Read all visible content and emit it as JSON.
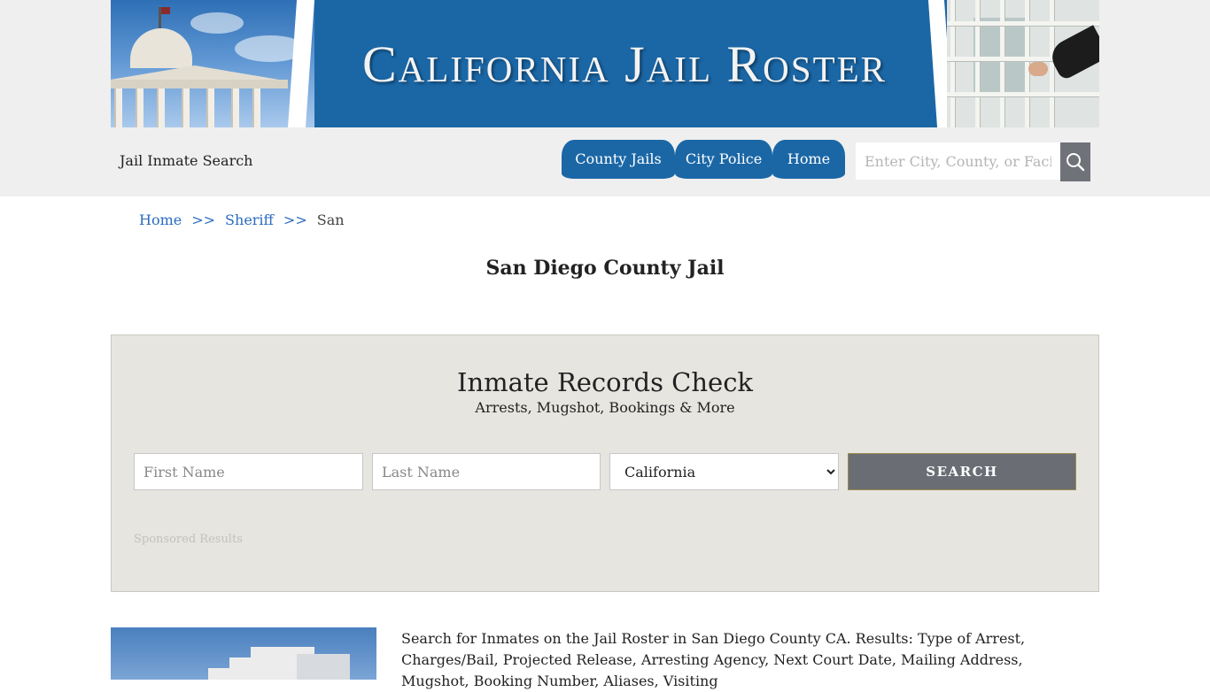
{
  "banner": {
    "title": "California Jail Roster"
  },
  "header": {
    "site_name": "Jail Inmate Search",
    "nav": [
      {
        "label": "County Jails"
      },
      {
        "label": "City Police"
      },
      {
        "label": "Home"
      }
    ],
    "search_placeholder": "Enter City, County, or Facility"
  },
  "breadcrumb": {
    "items": [
      "Home",
      "Sheriff"
    ],
    "separator": ">>",
    "current": "San"
  },
  "page": {
    "title": "San Diego County Jail"
  },
  "records": {
    "title": "Inmate Records Check",
    "subtitle": "Arrests, Mugshot, Bookings & More",
    "first_name_placeholder": "First Name",
    "last_name_placeholder": "Last Name",
    "state_selected": "California",
    "search_label": "SEARCH",
    "sponsored": "Sponsored Results"
  },
  "content": {
    "description": "Search for Inmates on the Jail Roster in San Diego County CA. Results: Type of Arrest, Charges/Bail, Projected Release, Arresting Agency, Next Court Date, Mailing Address, Mugshot, Booking Number, Aliases, Visiting"
  },
  "colors": {
    "brand_blue": "#1b67a6",
    "panel_bg": "#e7e5e0",
    "button_gray": "#6a6d74",
    "link_blue": "#2a6bc0"
  }
}
